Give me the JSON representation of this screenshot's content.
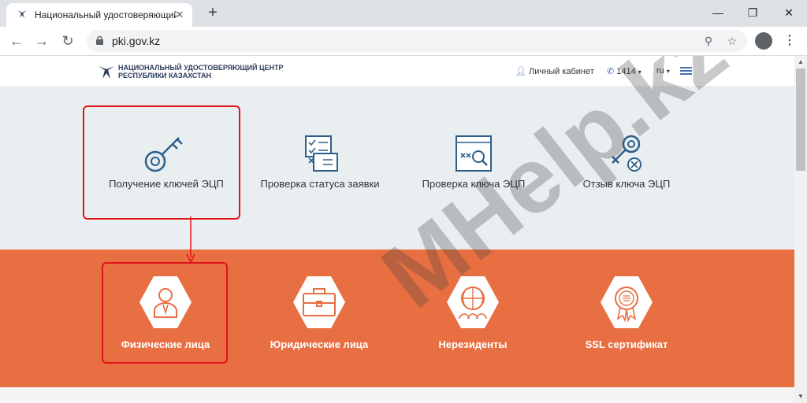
{
  "browser": {
    "tab_title": "Национальный удостоверяющий",
    "url": "pki.gov.kz"
  },
  "header": {
    "logo_line1": "НАЦИОНАЛЬНЫЙ УДОСТОВЕРЯЮЩИЙ ЦЕНТР",
    "logo_line2": "РЕСПУБЛИКИ КАЗАХСТАН",
    "cabinet": "Личный кабинет",
    "phone": "1414",
    "lang": "ru"
  },
  "services": [
    {
      "label": "Получение ключей ЭЦП",
      "icon": "key-icon"
    },
    {
      "label": "Проверка статуса заявки",
      "icon": "documents-check-icon"
    },
    {
      "label": "Проверка ключа ЭЦП",
      "icon": "key-search-icon"
    },
    {
      "label": "Отзыв ключа ЭЦП",
      "icon": "key-revoke-icon"
    }
  ],
  "categories": [
    {
      "label": "Физические лица",
      "icon": "person-icon"
    },
    {
      "label": "Юридические лица",
      "icon": "briefcase-icon"
    },
    {
      "label": "Нерезиденты",
      "icon": "globe-people-icon"
    },
    {
      "label": "SSL сертификат",
      "icon": "certificate-badge-icon"
    }
  ],
  "watermark": "MHelp.kz",
  "colors": {
    "accent": "#e86f42",
    "highlight": "#e0151b",
    "icon_blue": "#2e5f8a"
  }
}
